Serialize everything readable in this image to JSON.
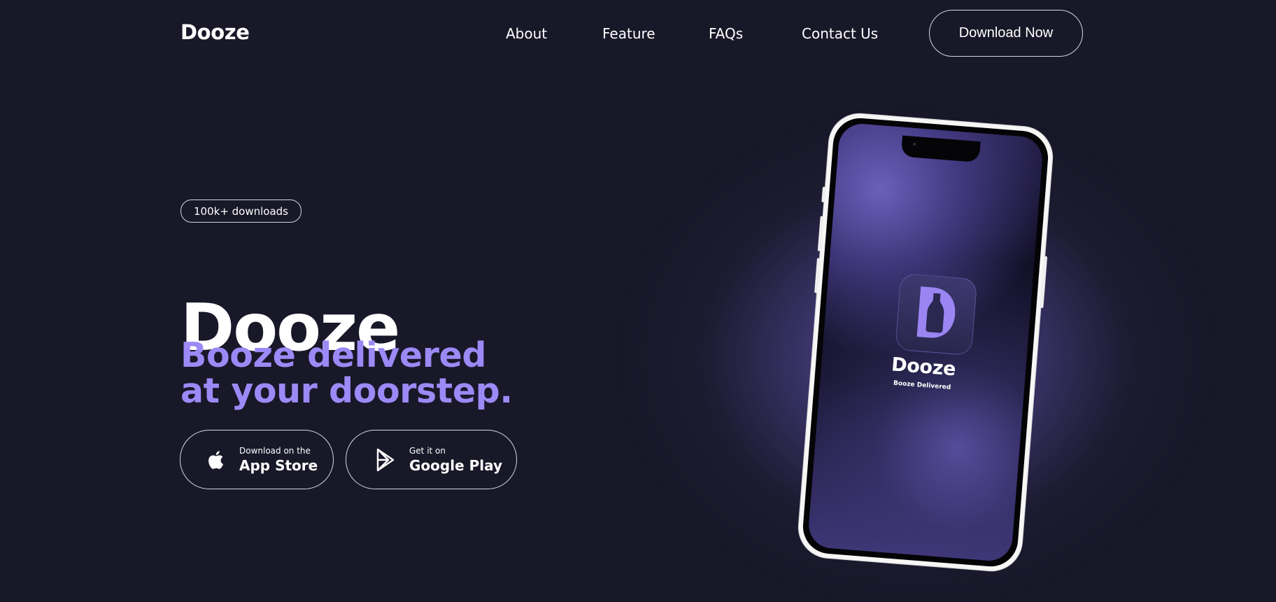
{
  "nav": {
    "brand": "Dooze",
    "links": [
      "About",
      "Feature",
      "FAQs",
      "Contact Us"
    ],
    "cta": "Download Now"
  },
  "hero": {
    "badge": "100k+ downloads",
    "title": "Dooze",
    "tagline_line1": "Booze delivered",
    "tagline_line2": "at your doorstep.",
    "app_store": {
      "small": "Download on the",
      "big": "App Store",
      "icon": "apple-icon"
    },
    "google_play": {
      "small": "Get it on",
      "big": "Google Play",
      "icon": "google-play-icon"
    }
  },
  "phone": {
    "app_name": "Dooze",
    "app_subtitle": "Booze Delivered",
    "icon": "bottle-icon"
  },
  "colors": {
    "background": "#181829",
    "accent": "#9d89f6",
    "white": "#ffffff"
  }
}
